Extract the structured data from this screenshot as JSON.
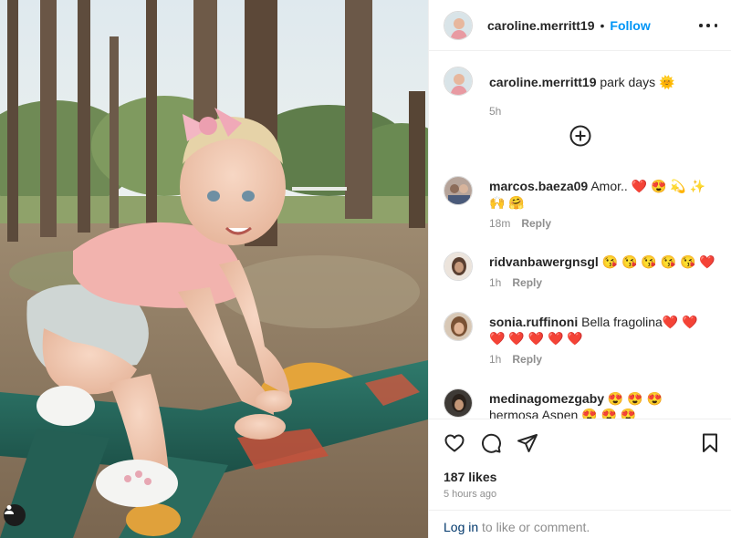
{
  "post": {
    "username": "caroline.merritt19",
    "separator": "•",
    "follow_label": "Follow",
    "caption_text": "park days 🌞",
    "caption_age": "5h",
    "likes": "187 likes",
    "posted": "5 hours ago"
  },
  "comments": [
    {
      "user": "marcos.baeza09",
      "text": "Amor.. ❤️ 😍 💫 ✨ 🙌 🤗",
      "age": "18m",
      "reply": "Reply"
    },
    {
      "user": "ridvanbawergnsgl",
      "text": "😘 😘 😘 😘 😘 ❤️",
      "age": "1h",
      "reply": "Reply"
    },
    {
      "user": "sonia.ruffinoni",
      "text": "Bella fragolina❤️ ❤️ ❤️ ❤️ ❤️ ❤️ ❤️",
      "age": "1h",
      "reply": "Reply"
    },
    {
      "user": "medinagomezgaby",
      "text": "😍 😍 😍 hermosa Aspen 😍 😍 😍",
      "age": "",
      "reply": ""
    }
  ],
  "footer": {
    "login_link": "Log in",
    "login_suffix": " to like or comment."
  },
  "icons": {
    "more": "more-options-icon",
    "load_more": "plus-circle-icon",
    "like": "heart-icon",
    "comment": "comment-icon",
    "share": "paper-plane-icon",
    "save": "bookmark-icon",
    "user_tag": "user-tag-icon"
  },
  "colors": {
    "link_blue": "#0095f6",
    "text": "#262626",
    "muted": "#8e8e8e",
    "login": "#00376b"
  }
}
